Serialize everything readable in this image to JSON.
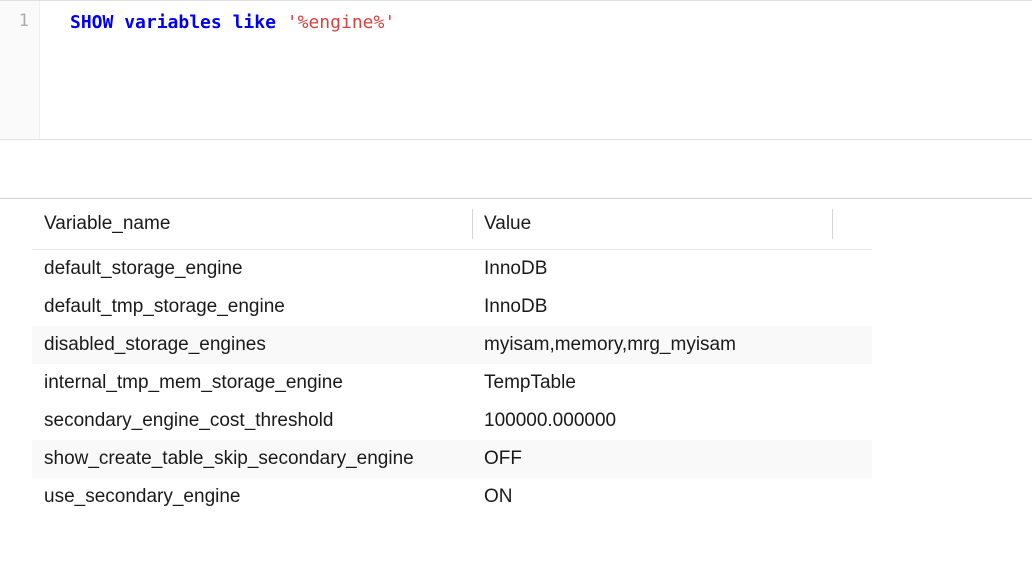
{
  "editor": {
    "line_number": "1",
    "tokens": {
      "show": "SHOW",
      "variables": "variables",
      "like": "like",
      "space": " ",
      "string": "'%engine%'"
    }
  },
  "results": {
    "headers": {
      "name": "Variable_name",
      "value": "Value"
    },
    "rows": [
      {
        "name": "default_storage_engine",
        "value": "InnoDB"
      },
      {
        "name": "default_tmp_storage_engine",
        "value": "InnoDB"
      },
      {
        "name": "disabled_storage_engines",
        "value": "myisam,memory,mrg_myisam"
      },
      {
        "name": "internal_tmp_mem_storage_engine",
        "value": "TempTable"
      },
      {
        "name": "secondary_engine_cost_threshold",
        "value": "100000.000000"
      },
      {
        "name": "show_create_table_skip_secondary_engine",
        "value": "OFF"
      },
      {
        "name": "use_secondary_engine",
        "value": "ON"
      }
    ]
  }
}
